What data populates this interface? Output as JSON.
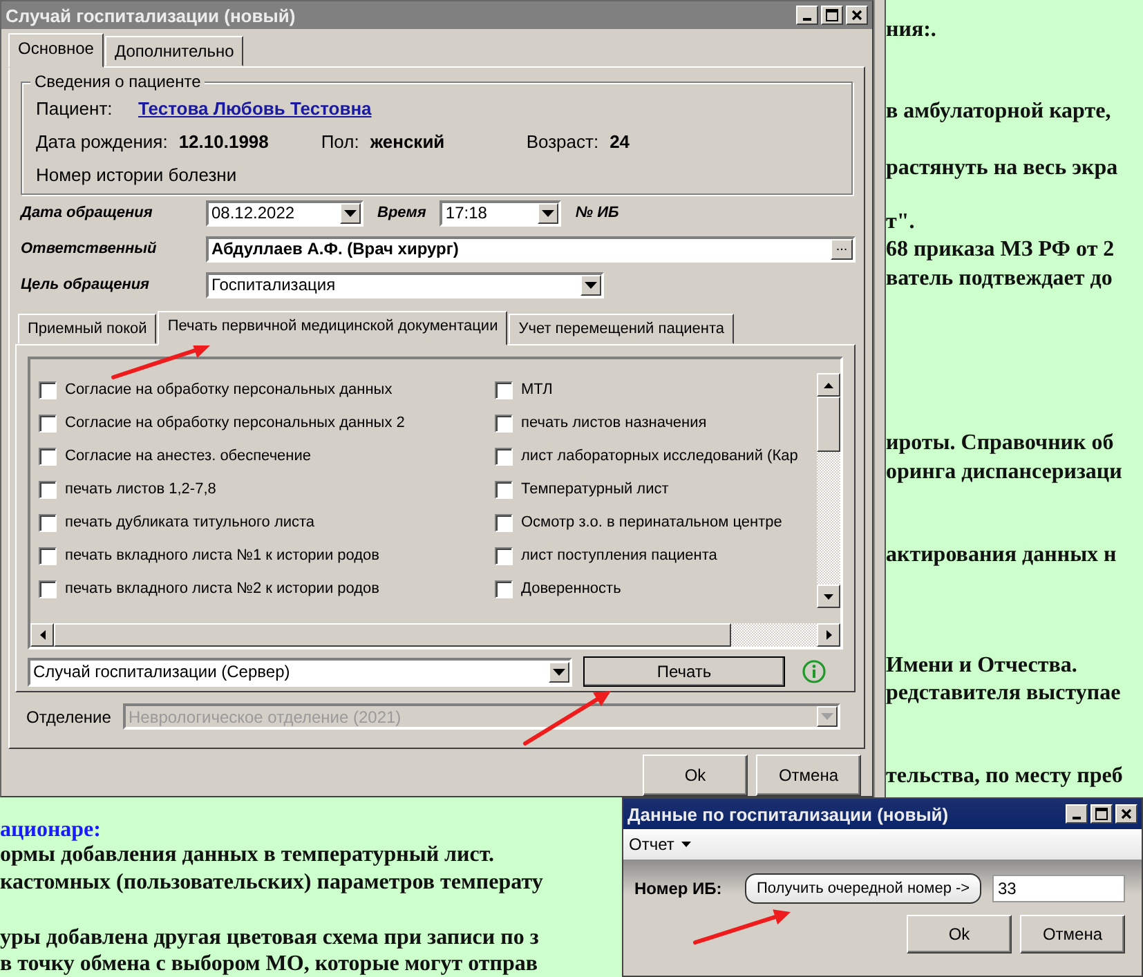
{
  "background_document": {
    "right_lines": [
      "ния:.",
      "в амбулаторной карте,",
      "растянуть на весь экра",
      "т\".",
      "68 приказа МЗ РФ от 2",
      "ватель подтвеждает до",
      "ироты. Справочник об",
      "оринга диспансеризаци",
      "актирования данных н",
      "Имени и Отчества.",
      "редставителя выступае",
      "тельства, по месту преб"
    ],
    "bottom_heading": "ационаре:",
    "bottom_lines": [
      "ормы добавления данных в температурный лист.",
      "кастомных (пользовательских) параметров температу",
      "уры добавлена другая цветовая схема при записи по з",
      "в точку обмена с выбором МО, которые могут отправ"
    ]
  },
  "main_window": {
    "title": "Случай госпитализации (новый)",
    "tabs": [
      {
        "label": "Основное",
        "selected": true
      },
      {
        "label": "Дополнительно",
        "selected": false
      }
    ],
    "patient_group": {
      "legend": "Сведения о пациенте",
      "patient_label": "Пациент:",
      "patient_name": "Тестова Любовь Тестовна",
      "birth_label": "Дата рождения:",
      "birth_date": "12.10.1998",
      "sex_label": "Пол:",
      "sex": "женский",
      "age_label": "Возраст:",
      "age": "24",
      "history_label": "Номер истории болезни"
    },
    "form": {
      "date_label": "Дата обращения",
      "date": "08.12.2022",
      "time_label": "Время",
      "time": "17:18",
      "ib_label": "№ ИБ",
      "responsible_label": "Ответственный",
      "responsible": "Абдуллаев А.Ф. (Врач хирург)",
      "responsible_button": "...",
      "purpose_label": "Цель обращения",
      "purpose": "Госпитализация"
    },
    "inner_tabs": [
      {
        "label": "Приемный покой",
        "selected": false
      },
      {
        "label": "Печать первичной медицинской документации",
        "selected": true
      },
      {
        "label": "Учет перемещений пациента",
        "selected": false
      }
    ],
    "documents_left": [
      {
        "label": "Согласие на обработку персональных данных",
        "checked": false
      },
      {
        "label": "Согласие на обработку персональных данных 2",
        "checked": false
      },
      {
        "label": "Согласие на анестез. обеспечение",
        "checked": false
      },
      {
        "label": "печать листов 1,2-7,8",
        "checked": false
      },
      {
        "label": "печать дубликата титульного листа",
        "checked": false
      },
      {
        "label": "печать вкладного листа №1 к истории родов",
        "checked": false
      },
      {
        "label": "печать вкладного листа №2 к истории родов",
        "checked": false
      }
    ],
    "documents_right": [
      {
        "label": "МТЛ",
        "checked": false
      },
      {
        "label": "печать листов назначения",
        "checked": false
      },
      {
        "label": "лист лабораторных исследований (Кар",
        "checked": false
      },
      {
        "label": "Температурный лист",
        "checked": false
      },
      {
        "label": "Осмотр з.о. в перинатальном центре",
        "checked": false
      },
      {
        "label": "лист поступления пациента",
        "checked": false
      },
      {
        "label": "Доверенность",
        "checked": false
      }
    ],
    "report": "Случай госпитализации (Сервер)",
    "print_button": "Печать",
    "department_label": "Отделение",
    "department": "Неврологическое отделение (2021)",
    "department_disabled": true,
    "buttons": [
      "Ok",
      "Отмена"
    ]
  },
  "hospitalization_dialog": {
    "title": "Данные по госпитализации (новый)",
    "menu": [
      {
        "label": "Отчет"
      }
    ],
    "ib_label": "Номер ИБ:",
    "next_number_button": "Получить очередной номер ->",
    "ib_value": "33",
    "buttons": [
      "Ok",
      "Отмена"
    ]
  }
}
